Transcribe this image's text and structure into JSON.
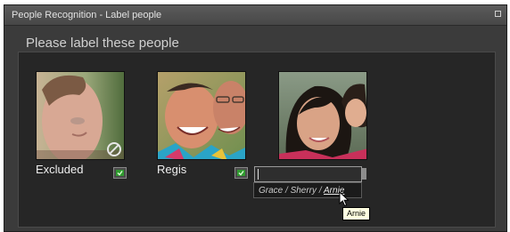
{
  "window": {
    "title": "People Recognition - Label people"
  },
  "heading": "Please label these people",
  "faces": [
    {
      "label": "Excluded",
      "status": "excluded",
      "icons": [
        "excluded-icon",
        "tag-icon"
      ]
    },
    {
      "label": "Regis",
      "status": "labeled",
      "icons": [
        "tag-icon"
      ]
    },
    {
      "label": "",
      "status": "editing",
      "icons": []
    }
  ],
  "name_input": {
    "value": "",
    "placeholder": ""
  },
  "suggestions": {
    "items": [
      "Grace",
      "Sherry",
      "Arnie"
    ],
    "separator": "/",
    "hovered": "Arnie"
  },
  "tooltip": {
    "text": "Arnie"
  },
  "colors": {
    "window_bg": "#3b3b3b",
    "panel_bg": "#262626",
    "tooltip_bg": "#ffffe1",
    "tag_icon": "#2f9a2f"
  }
}
